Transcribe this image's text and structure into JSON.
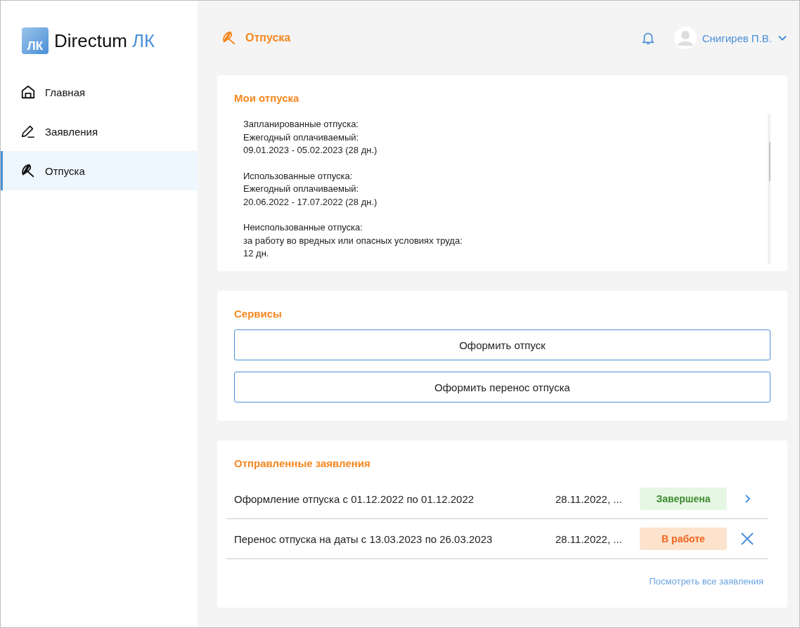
{
  "logo": {
    "brand": "Directum",
    "suffix": "ЛК",
    "badge": "ЛК"
  },
  "sidebar": {
    "items": [
      {
        "label": "Главная",
        "kind": "home",
        "selected": false
      },
      {
        "label": "Заявления",
        "kind": "pen",
        "selected": false
      },
      {
        "label": "Отпуска",
        "kind": "umbrella",
        "selected": true
      }
    ]
  },
  "header": {
    "title": "Отпуска",
    "user": "Снигирев П.В."
  },
  "my_vacations": {
    "title": "Мои отпуска",
    "blocks": [
      [
        "Запланированные отпуска:",
        "Ежегодный оплачиваемый:",
        "09.01.2023 - 05.02.2023 (28 дн.)"
      ],
      [
        "Использованные отпуска:",
        "Ежегодный оплачиваемый:",
        "20.06.2022 - 17.07.2022 (28 дн.)"
      ],
      [
        "Неиспользованные отпуска:",
        "за работу во вредных или опасных условиях труда:",
        "12 дн."
      ]
    ]
  },
  "services": {
    "title": "Сервисы",
    "buttons": [
      "Оформить отпуск",
      "Оформить перенос отпуска"
    ]
  },
  "requests": {
    "title": "Отправленные заявления",
    "rows": [
      {
        "title": "Оформление отпуска с 01.12.2022 по 01.12.2022",
        "date": "28.11.2022, ...",
        "status": "Завершена",
        "kind": "done"
      },
      {
        "title": "Перенос отпуска на даты с 13.03.2023 по 26.03.2023",
        "date": "28.11.2022, ...",
        "status": "В работе",
        "kind": "in_progress"
      }
    ],
    "link": "Посмотреть все заявления"
  }
}
